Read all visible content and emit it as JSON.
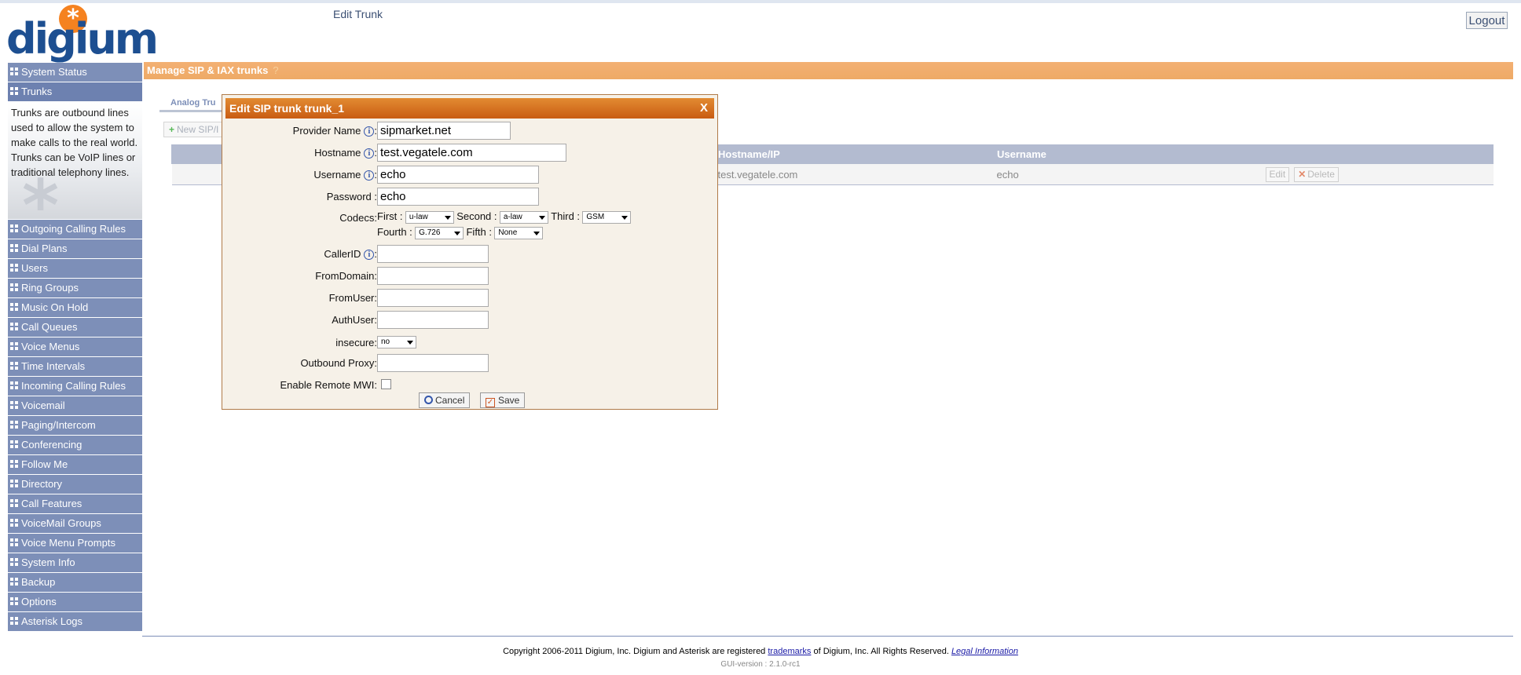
{
  "app": {
    "logo_text": "digium",
    "page_heading": "Edit Trunk",
    "logout_label": "Logout"
  },
  "sidebar": {
    "items_top": [
      {
        "label": "System Status"
      },
      {
        "label": "Trunks"
      }
    ],
    "description": "Trunks are outbound lines used to allow the system to make calls to the real world. Trunks can be VoIP lines or traditional telephony lines.",
    "items_bottom": [
      {
        "label": "Outgoing Calling Rules"
      },
      {
        "label": "Dial Plans"
      },
      {
        "label": "Users"
      },
      {
        "label": "Ring Groups"
      },
      {
        "label": "Music On Hold"
      },
      {
        "label": "Call Queues"
      },
      {
        "label": "Voice Menus"
      },
      {
        "label": "Time Intervals"
      },
      {
        "label": "Incoming Calling Rules"
      },
      {
        "label": "Voicemail"
      },
      {
        "label": "Paging/Intercom"
      },
      {
        "label": "Conferencing"
      },
      {
        "label": "Follow Me"
      },
      {
        "label": "Directory"
      },
      {
        "label": "Call Features"
      },
      {
        "label": "VoiceMail Groups"
      },
      {
        "label": "Voice Menu Prompts"
      },
      {
        "label": "System Info"
      },
      {
        "label": "Backup"
      },
      {
        "label": "Options"
      },
      {
        "label": "Asterisk Logs"
      }
    ]
  },
  "main": {
    "section_title": "Manage SIP & IAX trunks",
    "tabs": [
      {
        "label": "Analog Tru"
      }
    ],
    "new_button_label": "New SIP/I",
    "table": {
      "headers": [
        "Hostname/IP",
        "Username"
      ],
      "rows": [
        {
          "hostname": "test.vegatele.com",
          "username": "echo",
          "edit": "Edit",
          "delete": "Delete"
        }
      ]
    }
  },
  "dialog": {
    "title": "Edit SIP trunk trunk_1",
    "close_label": "X",
    "fields": {
      "provider_name": {
        "label": "Provider Name",
        "value": "sipmarket.net"
      },
      "hostname": {
        "label": "Hostname",
        "value": "test.vegatele.com"
      },
      "username": {
        "label": "Username",
        "value": "echo"
      },
      "password": {
        "label": "Password :",
        "value": "echo"
      },
      "callerid": {
        "label": "CallerID",
        "value": ""
      },
      "fromdomain": {
        "label": "FromDomain:",
        "value": ""
      },
      "fromuser": {
        "label": "FromUser:",
        "value": ""
      },
      "authuser": {
        "label": "AuthUser:",
        "value": ""
      },
      "insecure": {
        "label": "insecure:",
        "value": "no"
      },
      "outbound_proxy": {
        "label": "Outbound Proxy:",
        "value": ""
      },
      "enable_remote_mwi": {
        "label": "Enable Remote MWI:",
        "checked": false
      }
    },
    "codecs": {
      "label": "Codecs:",
      "first": {
        "label": "First :",
        "value": "u-law"
      },
      "second": {
        "label": "Second :",
        "value": "a-law"
      },
      "third": {
        "label": "Third :",
        "value": "GSM"
      },
      "fourth": {
        "label": "Fourth :",
        "value": "G.726"
      },
      "fifth": {
        "label": "Fifth :",
        "value": "None"
      }
    },
    "info_glyph": "i",
    "cancel_label": "Cancel",
    "save_label": "Save"
  },
  "footer": {
    "copyright_pre": "Copyright 2006-2011 Digium, Inc. Digium and Asterisk are registered",
    "trademarks_link": "trademarks",
    "copyright_post": "of Digium, Inc. All Rights Reserved.",
    "legal_link": "Legal Information",
    "version": "GUI-version : 2.1.0-rc1"
  }
}
